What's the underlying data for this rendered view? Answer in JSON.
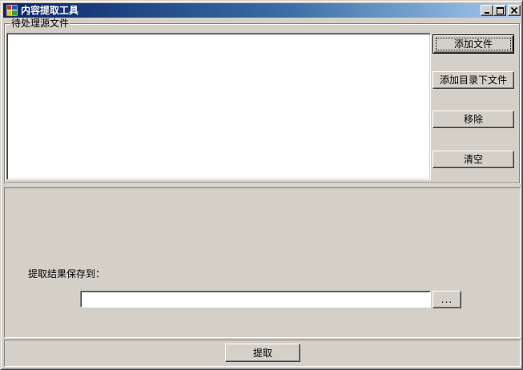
{
  "window": {
    "title": "内容提取工具",
    "icon": "app-window-icon",
    "controls": {
      "minimize_icon": "minimize-icon",
      "maximize_icon": "maximize-icon",
      "close_icon": "close-icon"
    }
  },
  "source_group": {
    "legend": "待处理源文件",
    "items": [],
    "buttons": {
      "add_file": "添加文件",
      "add_dir_files": "添加目录下文件",
      "remove": "移除",
      "clear": "清空"
    }
  },
  "output": {
    "label": "提取结果保存到：",
    "path_value": "",
    "browse_label": "..."
  },
  "actions": {
    "extract_label": "提取"
  },
  "colors": {
    "face": "#d4d0c8",
    "title_start": "#0a246a",
    "title_end": "#a6caf0",
    "title_text": "#ffffff"
  }
}
